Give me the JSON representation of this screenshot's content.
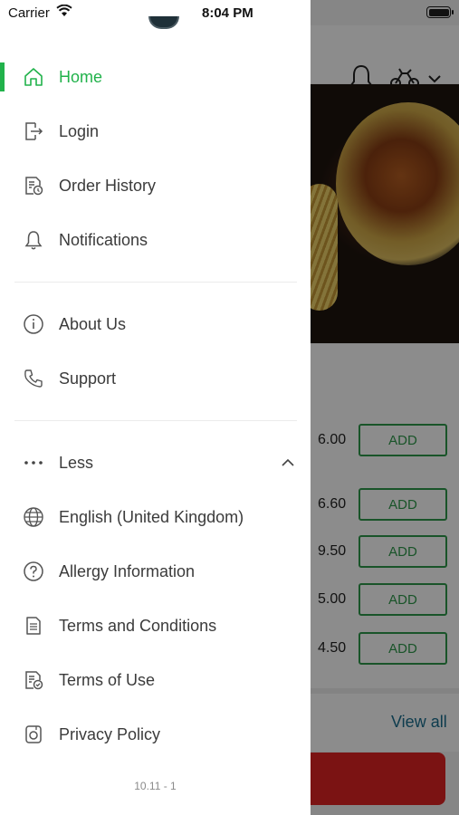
{
  "status_bar": {
    "carrier": "Carrier",
    "time": "8:04 PM"
  },
  "menu": {
    "primary": [
      {
        "label": "Home",
        "icon": "home-icon",
        "active": true
      },
      {
        "label": "Login",
        "icon": "login-icon"
      },
      {
        "label": "Order History",
        "icon": "order-history-icon"
      },
      {
        "label": "Notifications",
        "icon": "bell-icon"
      }
    ],
    "secondary": [
      {
        "label": "About Us",
        "icon": "info-icon"
      },
      {
        "label": "Support",
        "icon": "phone-icon"
      }
    ],
    "more": {
      "toggle_label": "Less",
      "items": [
        {
          "label": "English (United Kingdom)",
          "icon": "globe-icon"
        },
        {
          "label": "Allergy Information",
          "icon": "question-icon"
        },
        {
          "label": "Terms and Conditions",
          "icon": "document-icon"
        },
        {
          "label": "Terms of Use",
          "icon": "document-check-icon"
        },
        {
          "label": "Privacy Policy",
          "icon": "privacy-icon"
        }
      ]
    },
    "version": "10.11 - 1"
  },
  "background": {
    "prices": [
      "6.00",
      "6.60",
      "9.50",
      "5.00",
      "4.50"
    ],
    "add_label": "ADD",
    "view_all": "View all"
  },
  "colors": {
    "accent": "#21b24b",
    "add_button": "#2f9a4c",
    "cta": "#e02424",
    "link": "#1a6e8e"
  }
}
